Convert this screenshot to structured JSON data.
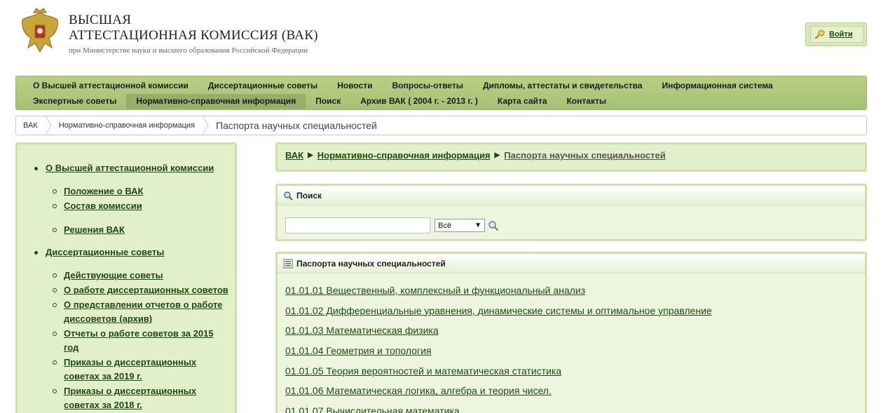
{
  "header": {
    "title_line1": "ВЫСШАЯ",
    "title_line2": "АТТЕСТАЦИОННАЯ КОМИССИЯ (ВАК)",
    "subtitle": "при Министерстве науки и высшего образования Российской Федерации",
    "emblem_icon": "coat-of-arms-icon",
    "login_label": "Войти",
    "login_icon": "key-icon"
  },
  "nav": {
    "row1": [
      {
        "label": "О Высшей аттестационной комиссии",
        "active": false
      },
      {
        "label": "Диссертационные советы",
        "active": false
      },
      {
        "label": "Новости",
        "active": false
      },
      {
        "label": "Вопросы-ответы",
        "active": false
      },
      {
        "label": "Дипломы, аттестаты и свидетельства",
        "active": false
      },
      {
        "label": "Информационная система",
        "active": false
      }
    ],
    "row2": [
      {
        "label": "Экспертные советы",
        "active": false
      },
      {
        "label": "Нормативно-справочная информация",
        "active": true
      },
      {
        "label": "Поиск",
        "active": false
      },
      {
        "label": "Архив ВАК ( 2004 г. - 2013 г. )",
        "active": false
      },
      {
        "label": "Карта сайта",
        "active": false
      },
      {
        "label": "Контакты",
        "active": false
      }
    ]
  },
  "breadcrumb_bar": {
    "items": [
      "ВАК",
      "Нормативно-справочная информация",
      "Паспорта научных специальностей"
    ]
  },
  "sidebar": {
    "sections": [
      {
        "label": "О Высшей аттестационной комиссии",
        "groups": [
          [
            "Положение о ВАК",
            "Состав комиссии"
          ],
          [
            "Решения ВАК"
          ]
        ]
      },
      {
        "label": "Диссертационные советы",
        "groups": [
          [
            "Действующие советы",
            "О работе диссертационных советов",
            "О представлении отчетов о работе диссоветов (архив)",
            "Отчеты о работе советов за 2015 год",
            "Приказы о диссертационных советах за 2019 г.",
            "Приказы о диссертационных советах за 2018 г."
          ]
        ]
      }
    ]
  },
  "main": {
    "path": {
      "items": [
        "ВАК",
        "Нормативно-справочная информация"
      ],
      "current": "Паспорта научных специальностей"
    },
    "search": {
      "title": "Поиск",
      "title_icon": "magnifier-icon",
      "input_value": "",
      "select_value": "Всё",
      "go_icon": "magnifier-icon"
    },
    "specialties": {
      "title": "Паспорта научных специальностей",
      "title_icon": "document-list-icon",
      "items": [
        "01.01.01 Вещественный, комплексный и функциональный анализ",
        "01.01.02 Дифференциальные уравнения, динамические системы и оптимальное управление",
        "01.01.03 Математическая физика",
        "01.01.04 Геометрия и топология",
        "01.01.05 Теория вероятностей и математическая статистика",
        "01.01.06 Математическая логика, алгебра и теория чисел.",
        "01.01.07 Вычислительная математика"
      ]
    }
  },
  "colors": {
    "nav_bg": "#a6c173",
    "panel_border": "#cfe0ad",
    "panel_bg": "#eef5df",
    "link": "#1e4a12"
  }
}
